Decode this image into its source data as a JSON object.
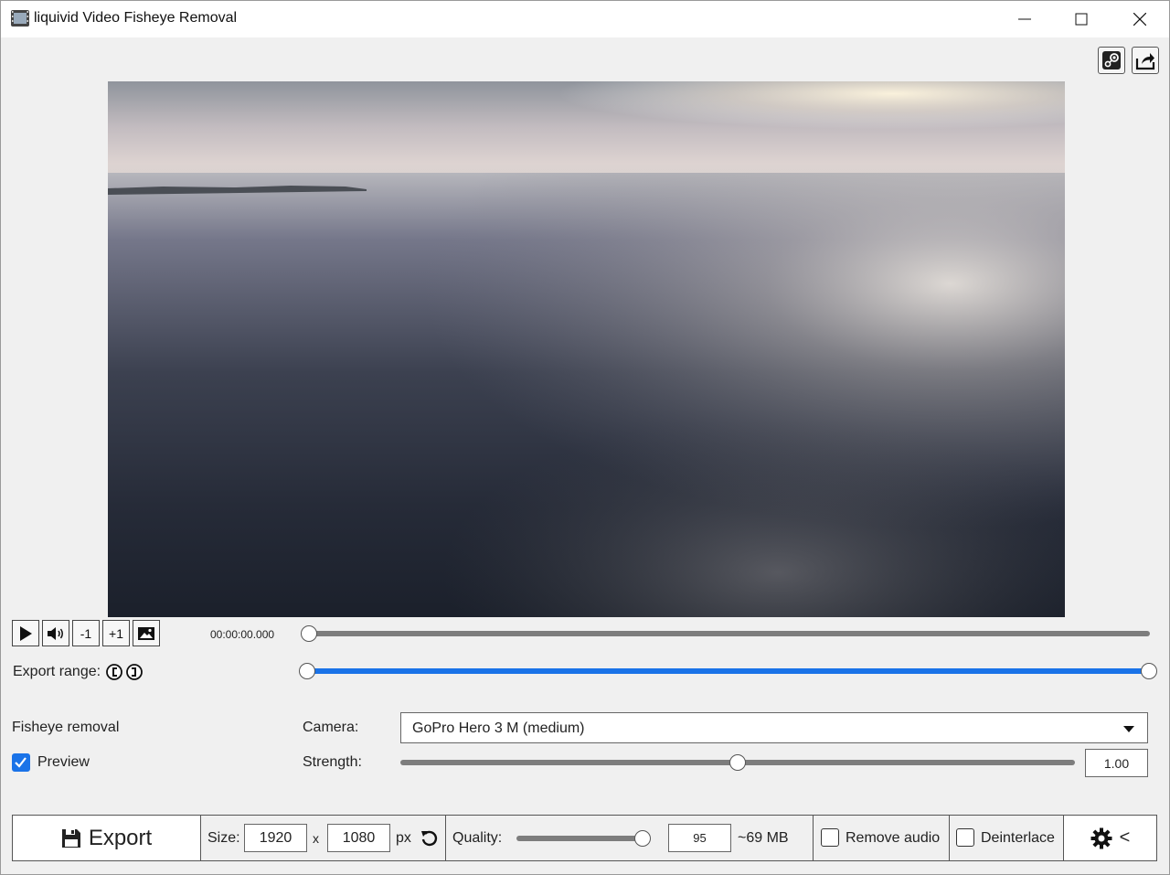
{
  "window": {
    "title": "liquivid Video Fisheye Removal",
    "icon": "film-icon",
    "controls": [
      "minimize-icon",
      "maximize-icon",
      "close-icon"
    ]
  },
  "toolbar_top": [
    "steam-icon",
    "share-icon"
  ],
  "playback": {
    "minus_one": "-1",
    "plus_one": "+1",
    "timecode": "00:00:00.000",
    "position_fraction": 0.0,
    "icons": [
      "play-icon",
      "volume-icon",
      "snapshot-icon"
    ]
  },
  "export_range": {
    "label": "Export range:",
    "start_fraction": 0.0,
    "end_fraction": 1.0,
    "icons": [
      "range-start-icon",
      "range-end-icon"
    ],
    "accent": "#1a73e8"
  },
  "fisheye": {
    "section_label": "Fisheye removal",
    "preview_label": "Preview",
    "preview_checked": true,
    "camera_label": "Camera:",
    "camera_value": "GoPro Hero 3 M (medium)",
    "strength_label": "Strength:",
    "strength_value": "1.00",
    "strength_fraction": 0.5
  },
  "bottom": {
    "export_label": "Export",
    "size_label": "Size:",
    "width": "1920",
    "times": "x",
    "height": "1080",
    "unit": "px",
    "quality_label": "Quality:",
    "quality_value": "95",
    "quality_fraction": 0.95,
    "estimated_size": "~69 MB",
    "remove_audio_label": "Remove audio",
    "remove_audio_checked": false,
    "deinterlace_label": "Deinterlace",
    "deinterlace_checked": false,
    "settings_arrow": "<"
  }
}
